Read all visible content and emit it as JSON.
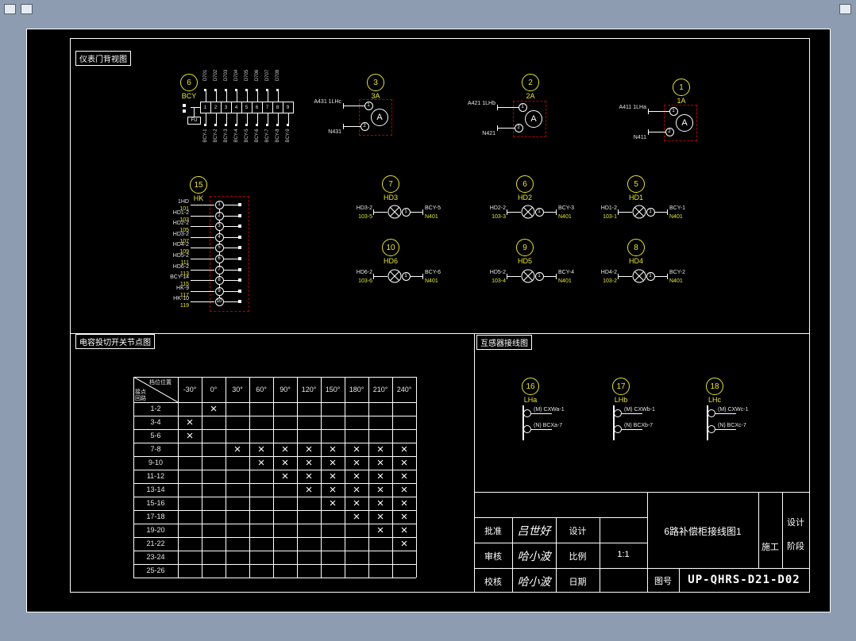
{
  "labels": {
    "instrument_view": "仪表门背视图",
    "switch_table": "电容投切开关节点图",
    "ct_diagram": "互感器接线图"
  },
  "components": {
    "bcy": {
      "num": "6",
      "name": "BCY",
      "fuse": "FU",
      "cells": [
        "1",
        "2",
        "3",
        "4",
        "5",
        "6",
        "7",
        "8",
        "9"
      ],
      "top_taps": [
        "D701",
        "D702",
        "D703",
        "D704",
        "D705",
        "D706",
        "D707",
        "D708"
      ],
      "bottom_taps": [
        "BCY-1",
        "BCY-2",
        "BCY-3",
        "BCY-4",
        "BCY-5",
        "BCY-6",
        "BCY-7",
        "BCY-8",
        "BCY-9"
      ]
    },
    "ammeter_letter": "A",
    "ammeters": [
      {
        "num": "3",
        "name": "3A",
        "t1": "1",
        "t2": "2",
        "top_label": "A431 1LHc",
        "bottom_label": "N431"
      },
      {
        "num": "2",
        "name": "2A",
        "t1": "1",
        "t2": "2",
        "top_label": "A421 1LHb",
        "bottom_label": "N421"
      },
      {
        "num": "1",
        "name": "1A",
        "t1": "1",
        "t2": "2",
        "top_label": "A411 1LHa",
        "bottom_label": "N411"
      }
    ],
    "hk": {
      "num": "15",
      "name": "HK",
      "rows": [
        {
          "n": "1",
          "code": "1HD",
          "wire": "101"
        },
        {
          "n": "2",
          "code": "HD1-2",
          "wire": "103"
        },
        {
          "n": "3",
          "code": "HD2-2",
          "wire": "105"
        },
        {
          "n": "4",
          "code": "HD3-2",
          "wire": "107"
        },
        {
          "n": "5",
          "code": "HD4-2",
          "wire": "109"
        },
        {
          "n": "6",
          "code": "HD5-2",
          "wire": "111"
        },
        {
          "n": "7",
          "code": "HD6-2",
          "wire": "113"
        },
        {
          "n": "8",
          "code": "BCY-14",
          "wire": "115"
        },
        {
          "n": "9",
          "code": "HK-9",
          "wire": "117"
        },
        {
          "n": "10",
          "code": "HK-10",
          "wire": "119"
        }
      ]
    },
    "lamps": [
      {
        "num": "7",
        "name": "HD3",
        "t": "1",
        "l1": "HD3-2",
        "l2": "103-5",
        "r1": "BCY-5",
        "r2": "N401"
      },
      {
        "num": "6",
        "name": "HD2",
        "t": "1",
        "l1": "HD2-2",
        "l2": "103-3",
        "r1": "BCY-3",
        "r2": "N401"
      },
      {
        "num": "5",
        "name": "HD1",
        "t": "1",
        "l1": "HD1-2",
        "l2": "103-1",
        "r1": "BCY-1",
        "r2": "N401"
      },
      {
        "num": "10",
        "name": "HD6",
        "t": "1",
        "l1": "HD6-2",
        "l2": "103-6",
        "r1": "BCY-6",
        "r2": "N401"
      },
      {
        "num": "9",
        "name": "HD5",
        "t": "1",
        "l1": "HD5-2",
        "l2": "103-4",
        "r1": "BCY-4",
        "r2": "N401"
      },
      {
        "num": "8",
        "name": "HD4",
        "t": "1",
        "l1": "HD4-2",
        "l2": "103-2",
        "r1": "BCY-2",
        "r2": "N401"
      }
    ],
    "cts": [
      {
        "num": "16",
        "name": "LHa",
        "w1": "(M) CXWa-1",
        "w2": "(N) BCXa-7"
      },
      {
        "num": "17",
        "name": "LHb",
        "w1": "(M) CXWb-1",
        "w2": "(N) BCXb-7"
      },
      {
        "num": "18",
        "name": "LHc",
        "w1": "(M) CXWc-1",
        "w2": "(N) BCXc-7"
      }
    ]
  },
  "table": {
    "corner_top": "档位位置",
    "corner_bottom1": "接点",
    "corner_bottom2": "回路",
    "mark": "×",
    "columns": [
      "-30°",
      "0°",
      "30°",
      "60°",
      "90°",
      "120°",
      "150°",
      "180°",
      "210°",
      "240°"
    ],
    "rows": [
      {
        "label": "1-2",
        "marks": [
          1
        ]
      },
      {
        "label": "3-4",
        "marks": [
          0
        ]
      },
      {
        "label": "5-6",
        "marks": [
          0
        ]
      },
      {
        "label": "7-8",
        "marks": [
          2,
          3,
          4,
          5,
          6,
          7,
          8,
          9
        ]
      },
      {
        "label": "9-10",
        "marks": [
          3,
          4,
          5,
          6,
          7,
          8,
          9
        ]
      },
      {
        "label": "11-12",
        "marks": [
          4,
          5,
          6,
          7,
          8,
          9
        ]
      },
      {
        "label": "13-14",
        "marks": [
          5,
          6,
          7,
          8,
          9
        ]
      },
      {
        "label": "15-16",
        "marks": [
          6,
          7,
          8,
          9
        ]
      },
      {
        "label": "17-18",
        "marks": [
          7,
          8,
          9
        ]
      },
      {
        "label": "19-20",
        "marks": [
          8,
          9
        ]
      },
      {
        "label": "21-22",
        "marks": [
          9
        ]
      },
      {
        "label": "23-24",
        "marks": []
      },
      {
        "label": "25-26",
        "marks": []
      }
    ]
  },
  "titleblock": {
    "rows": [
      {
        "label": "批准",
        "sig": "吕世好",
        "label2": "设计",
        "value": ""
      },
      {
        "label": "审核",
        "sig": "哈小波",
        "label2": "比例",
        "value": "1:1"
      },
      {
        "label": "校核",
        "sig": "哈小波",
        "label2": "日期",
        "value": ""
      }
    ],
    "drawing_title": "6路补偿柜接线图1",
    "stage_mid": "施工",
    "stage_right": [
      "设计",
      "阶段"
    ],
    "fig_no_label": "图号",
    "fig_no": "UP-QHRS-D21-D02"
  },
  "colors": {
    "yellow": "#e8e431",
    "red": "#b40000",
    "line": "#ffffff",
    "background": "#8d9cb0"
  }
}
